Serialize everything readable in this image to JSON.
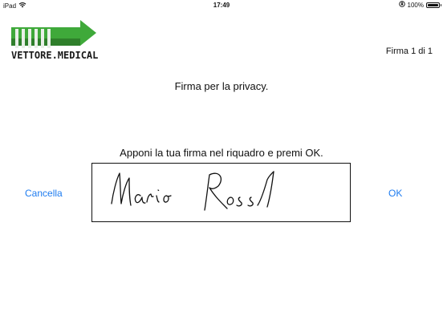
{
  "status_bar": {
    "device": "iPad",
    "time": "17:49",
    "battery": "100%",
    "icons": [
      "wifi-icon",
      "orientation-lock-icon",
      "battery-icon"
    ]
  },
  "header": {
    "logo_text": "VETTORE.MEDICAL",
    "page_counter": "Firma 1 di 1"
  },
  "document": {
    "title": "Firma per la privacy."
  },
  "signature": {
    "instruction": "Apponi la tua firma nel riquadro e premi OK.",
    "signed_name": "Mario Rossi"
  },
  "actions": {
    "cancel_label": "Cancella",
    "ok_label": "OK"
  },
  "colors": {
    "accent": "#1e7cf0",
    "logo_green": "#3fa93a",
    "text": "#111111"
  }
}
